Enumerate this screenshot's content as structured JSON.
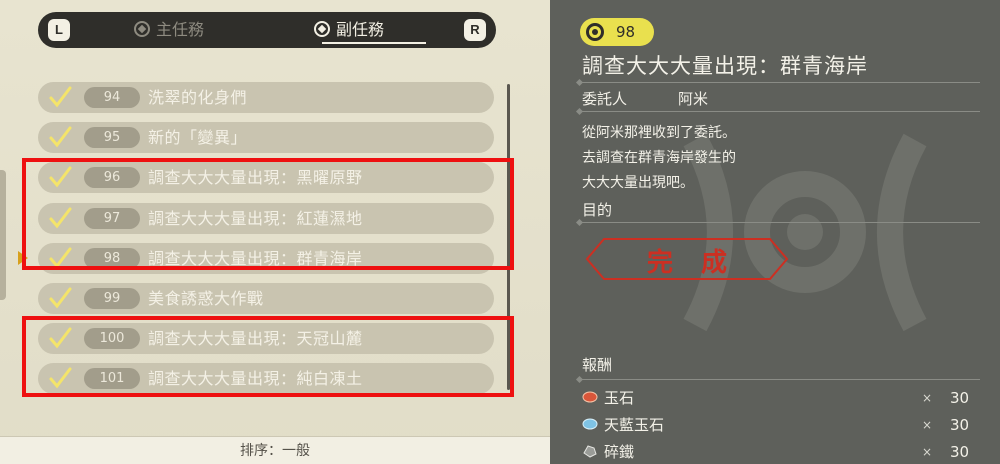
{
  "tabbar": {
    "left_key": "L",
    "right_key": "R",
    "tabs": [
      {
        "label": "主任務",
        "icon": "main-quest-icon",
        "active": false
      },
      {
        "label": "副任務",
        "icon": "side-quest-icon",
        "active": true
      }
    ]
  },
  "quests": [
    {
      "number": "94",
      "title": "洗翠的化身們",
      "completed": true
    },
    {
      "number": "95",
      "title": "新的「變異」",
      "completed": true
    },
    {
      "number": "96",
      "title": "調查大大大量出現：黑曜原野",
      "completed": true
    },
    {
      "number": "97",
      "title": "調查大大大量出現：紅蓮濕地",
      "completed": true
    },
    {
      "number": "98",
      "title": "調查大大大量出現：群青海岸",
      "completed": true,
      "selected": true
    },
    {
      "number": "99",
      "title": "美食誘惑大作戰",
      "completed": true
    },
    {
      "number": "100",
      "title": "調查大大大量出現：天冠山麓",
      "completed": true
    },
    {
      "number": "101",
      "title": "調查大大大量出現：純白凍土",
      "completed": true
    }
  ],
  "sort": {
    "label": "排序：一般"
  },
  "detail": {
    "badge_number": "98",
    "title": "調查大大大量出現：群青海岸",
    "client_label": "委託人",
    "client_name": "阿米",
    "description": [
      "從阿米那裡收到了委託。",
      "去調查在群青海岸發生的",
      "大大大量出現吧。"
    ],
    "objective_label": "目的",
    "status_stamp": "完成",
    "reward_label": "報酬",
    "rewards": [
      {
        "name": "玉石",
        "icon": "red-gem-icon",
        "times": "×",
        "quantity": "30"
      },
      {
        "name": "天藍玉石",
        "icon": "blue-gem-icon",
        "times": "×",
        "quantity": "30"
      },
      {
        "name": "碎鐵",
        "icon": "iron-chunk-icon",
        "times": "×",
        "quantity": "30"
      }
    ]
  },
  "colors": {
    "highlight_box": "#ee1010",
    "stamp": "#cc2f22",
    "badge": "#e9e04e",
    "check": "#f4e46a"
  }
}
